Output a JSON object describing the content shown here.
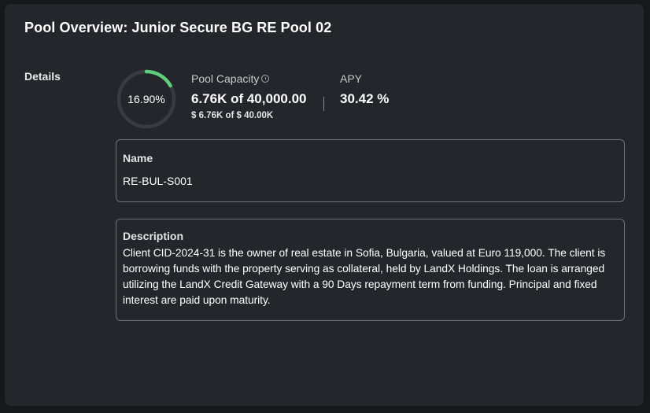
{
  "card": {
    "title": "Pool Overview: Junior Secure BG RE Pool 02"
  },
  "details": {
    "section_label": "Details",
    "gauge": {
      "percent_text": "16.90%",
      "fraction": 0.169,
      "track_color": "#3a3b40",
      "fill_color": "#5fce7c"
    },
    "capacity": {
      "label": "Pool Capacity",
      "info_icon": "info-circle-icon",
      "value": "6.76K of 40,000.00",
      "sub_value": "$ 6.76K of $ 40.00K"
    },
    "apy": {
      "label": "APY",
      "value": "30.42 %"
    }
  },
  "name_field": {
    "label": "Name",
    "value": "RE-BUL-S001"
  },
  "description_field": {
    "label": "Description",
    "value": "Client CID-2024-31 is the owner of real estate in Sofia, Bulgaria, valued at Euro 119,000. The client is borrowing funds with the property serving as collateral, held by LandX Holdings. The loan is arranged utilizing the LandX Credit Gateway with a 90 Days repayment term from funding. Principal and fixed interest are paid upon maturity."
  }
}
